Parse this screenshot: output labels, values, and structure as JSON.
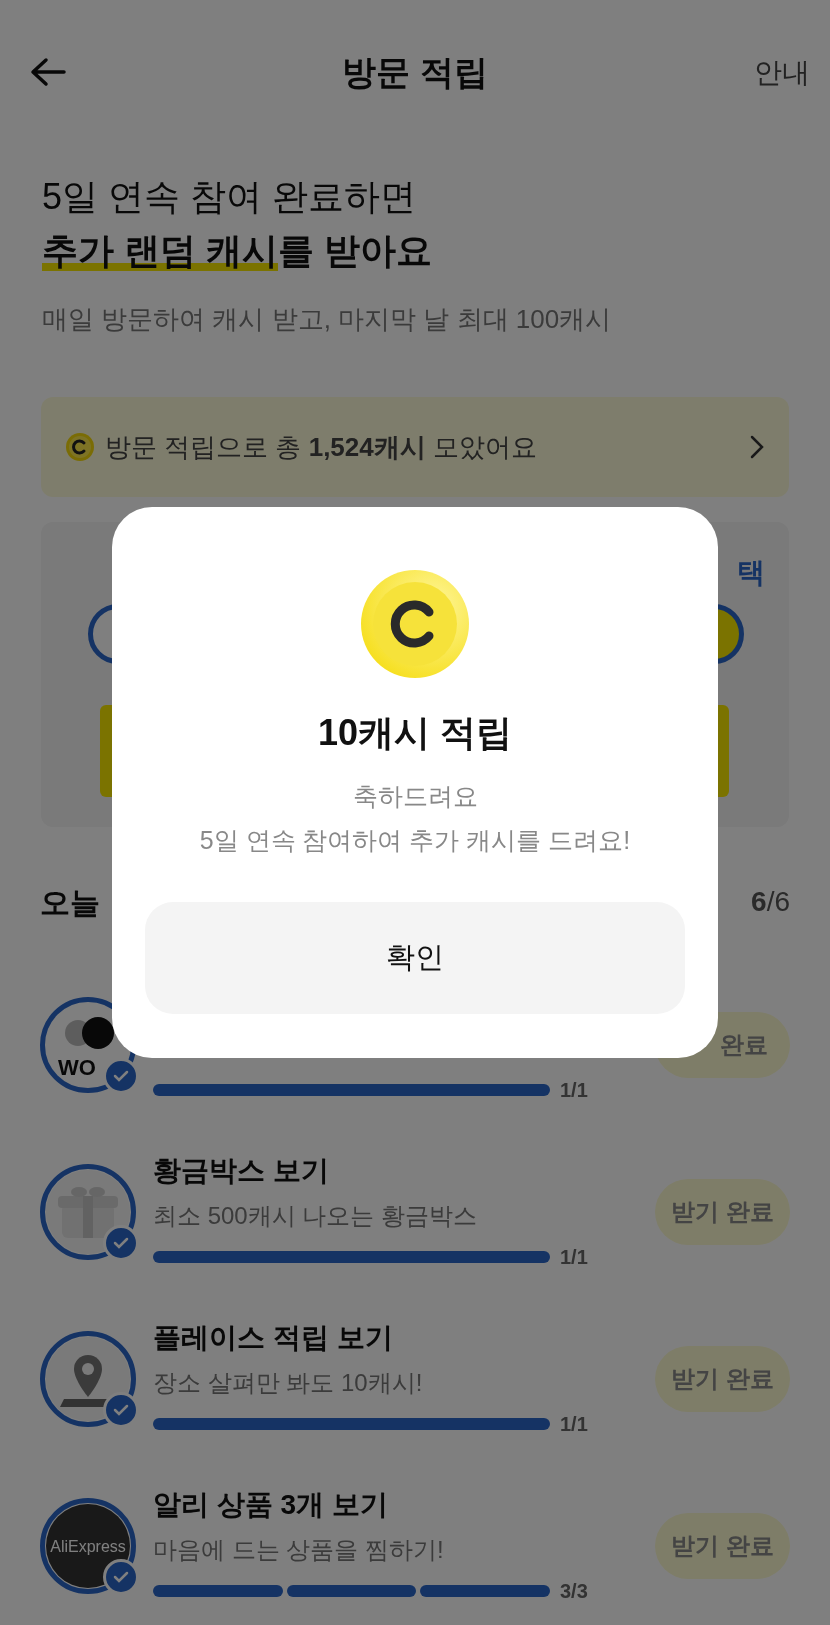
{
  "header": {
    "title": "방문 적립",
    "info_link": "안내"
  },
  "headline": {
    "line1": "5일 연속 참여 완료하면",
    "line2_highlight": "추가 랜덤 캐시",
    "line2_rest": "를 받아요"
  },
  "subtitle": "매일 방문하여 캐시 받고, 마지막 날 최대 100캐시",
  "total_banner": {
    "text": "방문 적립으로 총 **1,524캐시** 모았어요"
  },
  "streak_card": {
    "visible_label": "택"
  },
  "today": {
    "title": "오늘",
    "count": "**6**/6"
  },
  "tasks": [
    {
      "kind": "wow",
      "logo_text": "WO",
      "progress_label": "1/1",
      "steps": [
        {
          "done": true
        }
      ],
      "button": "완료",
      "completed": true
    },
    {
      "kind": "gift",
      "title": "황금박스 보기",
      "subtitle": "최소 500캐시 나오는 황금박스",
      "progress_label": "1/1",
      "steps": [
        {
          "done": true
        }
      ],
      "button": "받기 완료",
      "completed": true
    },
    {
      "kind": "pin",
      "title": "플레이스 적립 보기",
      "subtitle": "장소 살펴만 봐도 10캐시!",
      "progress_label": "1/1",
      "steps": [
        {
          "done": true
        }
      ],
      "button": "받기 완료",
      "completed": true
    },
    {
      "kind": "aliexpress",
      "logo_text": "AliExpress",
      "title": "알리 상품 3개 보기",
      "subtitle": "마음에 드는 상품을 찜하기!",
      "progress_label": "3/3",
      "steps": [
        {
          "done": true
        },
        {
          "done": true
        },
        {
          "done": true
        }
      ],
      "button": "받기 완료",
      "completed": true
    }
  ],
  "dialog": {
    "title": "10캐시 적립",
    "message_lines": [
      "축하드려요",
      "5일 연속 참여하여 추가 캐시를 드려요!"
    ],
    "button": "확인"
  }
}
